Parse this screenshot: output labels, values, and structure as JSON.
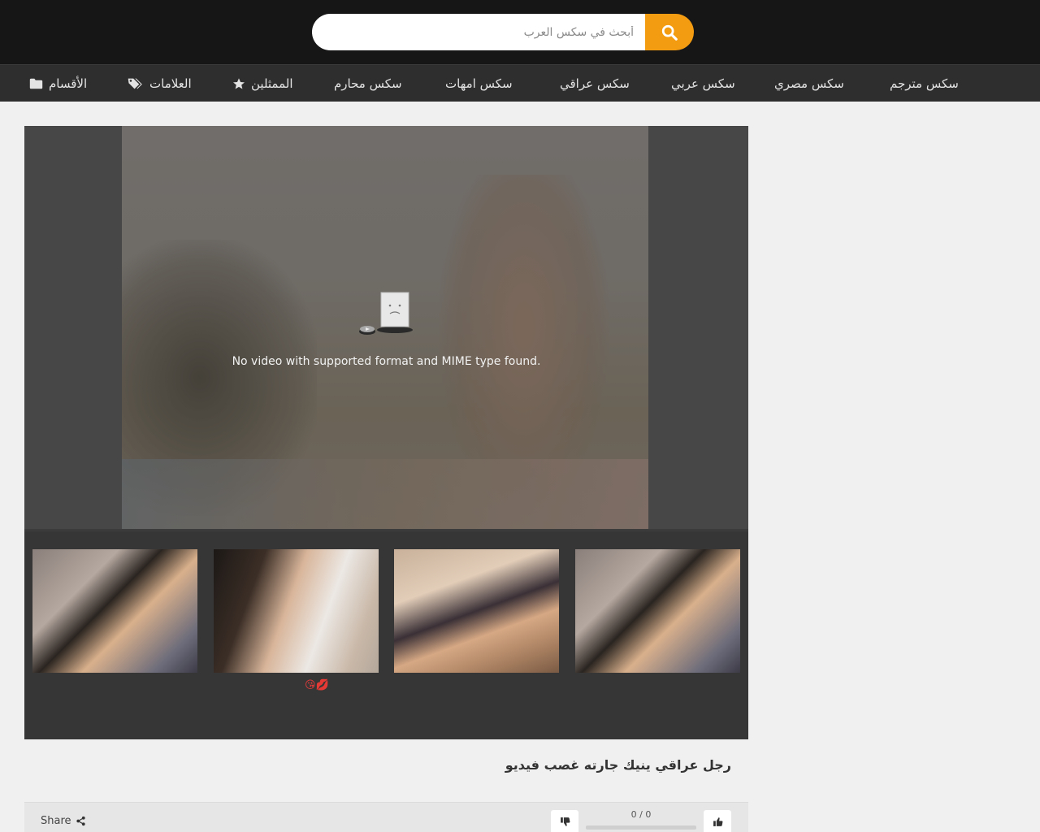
{
  "search": {
    "placeholder": "أبحث في سكس العرب"
  },
  "nav": {
    "items": [
      {
        "label": "سكس مترجم"
      },
      {
        "label": "سكس مصري"
      },
      {
        "label": "سكس عربي"
      },
      {
        "label": "سكس عراقي"
      },
      {
        "label": "سكس امهات"
      },
      {
        "label": "سكس محارم"
      },
      {
        "label": "الممثلين",
        "icon": "star-icon"
      },
      {
        "label": "العلامات",
        "icon": "tags-icon"
      },
      {
        "label": "الأقسام",
        "icon": "folder-icon"
      }
    ]
  },
  "player": {
    "error_message": "No video with supported format and MIME type found.",
    "emoji": "😘💋"
  },
  "video": {
    "title": "رجل عراقي ينيك جارته غصب فيديو",
    "share_label": "Share",
    "rating": "0 / 0"
  },
  "colors": {
    "accent": "#f39c12",
    "topbar": "#161616",
    "navbar": "#2e2e2e"
  }
}
